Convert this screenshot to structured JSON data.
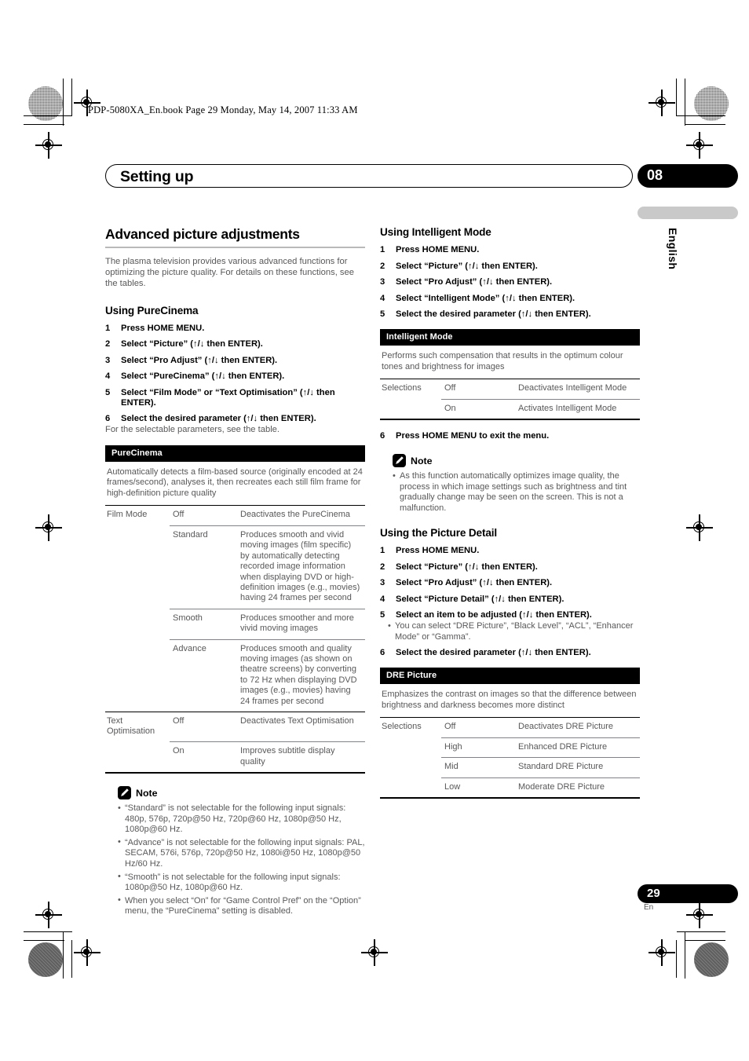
{
  "print": {
    "book_header": "PDP-5080XA_En.book  Page 29  Monday, May 14, 2007  11:33 AM"
  },
  "header": {
    "chapter_title": "Setting up",
    "chapter_number": "08",
    "language_tab": "English"
  },
  "footer": {
    "page_number": "29",
    "page_language": "En"
  },
  "left_column": {
    "section_title": "Advanced picture adjustments",
    "intro": "The plasma television provides various advanced functions for optimizing the picture quality. For details on these functions, see the tables.",
    "purecinema": {
      "heading": "Using PureCinema",
      "steps": [
        {
          "num": "1",
          "text": "Press HOME MENU."
        },
        {
          "num": "2",
          "text": "Select “Picture” (↑/↓ then ENTER)."
        },
        {
          "num": "3",
          "text": "Select “Pro Adjust” (↑/↓ then ENTER)."
        },
        {
          "num": "4",
          "text": "Select “PureCinema” (↑/↓ then ENTER)."
        },
        {
          "num": "5",
          "text": "Select “Film Mode” or “Text Optimisation” (↑/↓ then ENTER)."
        },
        {
          "num": "6",
          "text": "Select the desired parameter (↑/↓ then ENTER)."
        }
      ],
      "step_note": "For the selectable parameters, see the table."
    },
    "purecinema_table": {
      "caption": "PureCinema",
      "description": "Automatically detects a film-based source (originally encoded at 24 frames/second), analyses it, then recreates each still film frame for high-definition picture quality",
      "rows": [
        {
          "group": "Film Mode",
          "option": "Off",
          "detail": "Deactivates the PureCinema",
          "rule": "full"
        },
        {
          "group": "",
          "option": "Standard",
          "detail": "Produces smooth and vivid moving images (film specific) by automatically detecting recorded image information when displaying DVD or high-definition images (e.g., movies) having 24 frames per second",
          "rule": "thin"
        },
        {
          "group": "",
          "option": "Smooth",
          "detail": "Produces smoother and more vivid moving images",
          "rule": "thin"
        },
        {
          "group": "",
          "option": "Advance",
          "detail": "Produces smooth and quality moving images (as shown on theatre screens) by converting to 72 Hz when displaying DVD images (e.g., movies) having 24 frames per second",
          "rule": "thin"
        },
        {
          "group": "Text Optimisation",
          "option": "Off",
          "detail": "Deactivates Text Optimisation",
          "rule": "full"
        },
        {
          "group": "",
          "option": "On",
          "detail": "Improves subtitle display quality",
          "rule": "thin"
        }
      ]
    },
    "note": {
      "label": "Note",
      "icon": "pencil-icon",
      "items": [
        "“Standard” is not selectable for the following input signals: 480p, 576p, 720p@50 Hz, 720p@60 Hz, 1080p@50 Hz, 1080p@60 Hz.",
        "“Advance” is not selectable for the following input signals: PAL, SECAM, 576i, 576p, 720p@50 Hz, 1080i@50 Hz, 1080p@50 Hz/60 Hz.",
        "“Smooth” is not selectable for the following input signals: 1080p@50 Hz, 1080p@60 Hz.",
        "When you select “On” for “Game Control Pref” on the “Option” menu, the “PureCinema” setting is disabled."
      ]
    }
  },
  "right_column": {
    "intelligent": {
      "heading": "Using Intelligent Mode",
      "steps": [
        {
          "num": "1",
          "text": "Press HOME MENU."
        },
        {
          "num": "2",
          "text": "Select “Picture” (↑/↓ then ENTER)."
        },
        {
          "num": "3",
          "text": "Select “Pro Adjust” (↑/↓ then ENTER)."
        },
        {
          "num": "4",
          "text": "Select “Intelligent Mode” (↑/↓ then ENTER)."
        },
        {
          "num": "5",
          "text": "Select the desired parameter (↑/↓ then ENTER)."
        }
      ],
      "final_step": {
        "num": "6",
        "text": "Press HOME MENU to exit the menu."
      }
    },
    "intelligent_table": {
      "caption": "Intelligent Mode",
      "description": "Performs such compensation that results in the optimum colour tones and brightness for images",
      "rows": [
        {
          "group": "Selections",
          "option": "Off",
          "detail": "Deactivates Intelligent Mode",
          "rule": "full"
        },
        {
          "group": "",
          "option": "On",
          "detail": "Activates Intelligent Mode",
          "rule": "thin"
        }
      ]
    },
    "note": {
      "label": "Note",
      "icon": "pencil-icon",
      "items": [
        "As this function automatically optimizes image quality, the process in which image settings such as brightness and tint gradually change may be seen on the screen. This is not a malfunction."
      ]
    },
    "picture_detail": {
      "heading": "Using the Picture Detail",
      "steps": [
        {
          "num": "1",
          "text": "Press HOME MENU."
        },
        {
          "num": "2",
          "text": "Select “Picture” (↑/↓ then ENTER)."
        },
        {
          "num": "3",
          "text": "Select “Pro Adjust” (↑/↓ then ENTER)."
        },
        {
          "num": "4",
          "text": "Select “Picture Detail” (↑/↓ then ENTER)."
        },
        {
          "num": "5",
          "text": "Select an item to be adjusted (↑/↓ then ENTER)."
        }
      ],
      "substep": "You can select “DRE Picture”, “Black Level”, “ACL”,  “Enhancer Mode” or “Gamma”.",
      "final_step": {
        "num": "6",
        "text": "Select the desired parameter (↑/↓ then ENTER)."
      }
    },
    "dre_table": {
      "caption": "DRE Picture",
      "description": "Emphasizes the contrast on images so that the difference between brightness and darkness becomes more distinct",
      "rows": [
        {
          "group": "Selections",
          "option": "Off",
          "detail": "Deactivates DRE Picture",
          "rule": "full"
        },
        {
          "group": "",
          "option": "High",
          "detail": "Enhanced DRE Picture",
          "rule": "thin"
        },
        {
          "group": "",
          "option": "Mid",
          "detail": "Standard DRE Picture",
          "rule": "thin"
        },
        {
          "group": "",
          "option": "Low",
          "detail": "Moderate DRE Picture",
          "rule": "thin"
        }
      ]
    }
  }
}
